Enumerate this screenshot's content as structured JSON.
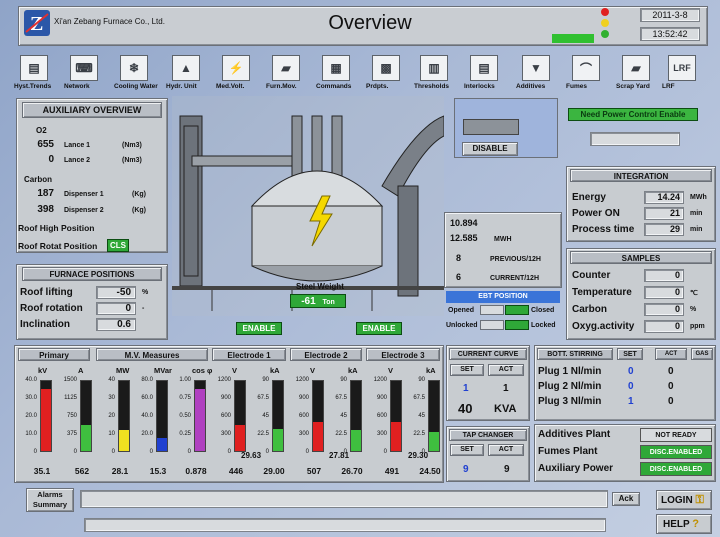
{
  "header": {
    "company": "Xi'an Zebang Furnace Co., Ltd.",
    "title": "Overview",
    "date": "2011-3-8",
    "time": "13:52:42"
  },
  "toolbar": [
    {
      "label": "Hyst.Trends",
      "icon": "trend-icon"
    },
    {
      "label": "Network",
      "icon": "network-icon"
    },
    {
      "label": "Cooling Water",
      "icon": "cooling-water-icon"
    },
    {
      "label": "Hydr. Unit",
      "icon": "hydraulic-icon"
    },
    {
      "label": "Med.Volt.",
      "icon": "medium-voltage-icon"
    },
    {
      "label": "Furn.Mov.",
      "icon": "furnace-movement-icon"
    },
    {
      "label": "Commands",
      "icon": "commands-icon"
    },
    {
      "label": "Prdpts.",
      "icon": "production-icon"
    },
    {
      "label": "Thresholds",
      "icon": "thresholds-icon"
    },
    {
      "label": "Interlocks",
      "icon": "interlocks-icon"
    },
    {
      "label": "Additives",
      "icon": "additives-icon"
    },
    {
      "label": "Fumes",
      "icon": "fumes-icon"
    },
    {
      "label": "Scrap Yard",
      "icon": "scrap-yard-icon"
    },
    {
      "label": "LRF",
      "icon": "lrf-icon"
    }
  ],
  "auxiliary": {
    "title": "AUXILIARY OVERVIEW",
    "o2_label": "O2",
    "lance1": {
      "value": "655",
      "label": "Lance 1",
      "unit": "(Nm3)"
    },
    "lance2": {
      "value": "0",
      "label": "Lance 2",
      "unit": "(Nm3)"
    },
    "carbon_label": "Carbon",
    "disp1": {
      "value": "187",
      "label": "Dispenser 1",
      "unit": "(Kg)"
    },
    "disp2": {
      "value": "398",
      "label": "Dispenser 2",
      "unit": "(Kg)"
    },
    "roof_high": "Roof High Position",
    "roof_rotat": "Roof Rotat Position",
    "roof_rotat_badge": "CLS"
  },
  "furnace_positions": {
    "title": "FURNACE POSITIONS",
    "rows": [
      {
        "label": "Roof lifting",
        "value": "-50",
        "unit": "%"
      },
      {
        "label": "Roof rotation",
        "value": "0",
        "unit": "-"
      },
      {
        "label": "Inclination",
        "value": "0.6",
        "unit": ""
      }
    ]
  },
  "center": {
    "steel_weight_label": "Steel Weight",
    "steel_weight_value": "-61",
    "steel_weight_unit": "Ton",
    "enable_left": "ENABLE",
    "enable_right": "ENABLE",
    "disable": "DISABLE"
  },
  "energy": {
    "v1": "10.894",
    "v2": "12.585",
    "unit": "MWH",
    "prev_val": "8",
    "prev_label": "PREVIOUS/12H",
    "curr_val": "6",
    "curr_label": "CURRENT/12H"
  },
  "ebt": {
    "title": "EBT POSITION",
    "opened": "Opened",
    "closed": "Closed",
    "unlocked": "Unlocked",
    "locked": "Locked"
  },
  "power_control": {
    "label": "Need Power Control Enable"
  },
  "integration": {
    "title": "INTEGRATION",
    "rows": [
      {
        "label": "Energy",
        "value": "14.24",
        "unit": "MWh"
      },
      {
        "label": "Power ON",
        "value": "21",
        "unit": "min"
      },
      {
        "label": "Process time",
        "value": "29",
        "unit": "min"
      }
    ]
  },
  "samples": {
    "title": "SAMPLES",
    "rows": [
      {
        "label": "Counter",
        "value": "0",
        "unit": ""
      },
      {
        "label": "Temperature",
        "value": "0",
        "unit": "℃"
      },
      {
        "label": "Carbon",
        "value": "0",
        "unit": "%"
      },
      {
        "label": "Oxyg.activity",
        "value": "0",
        "unit": "ppm"
      }
    ]
  },
  "gauges": {
    "primary_title": "Primary",
    "mv_title": "M.V. Measures",
    "e1_title": "Electrode 1",
    "e2_title": "Electrode 2",
    "e3_title": "Electrode 3",
    "columns": [
      {
        "unit": "kV",
        "ticks": [
          "40.0",
          "30.0",
          "20.0",
          "10.0",
          "0"
        ],
        "value": "35.1",
        "fill": 0.88,
        "color": "#e02020"
      },
      {
        "unit": "A",
        "ticks": [
          "1500",
          "1125",
          "750",
          "375",
          "0"
        ],
        "value": "562",
        "fill": 0.37,
        "color": "#3fbf3f"
      },
      {
        "unit": "MW",
        "ticks": [
          "40",
          "30",
          "20",
          "10",
          "0"
        ],
        "value": "28.1",
        "fill": 0.3,
        "color": "#f0e020"
      },
      {
        "unit": "MVar",
        "ticks": [
          "80.0",
          "60.0",
          "40.0",
          "20.0",
          "0"
        ],
        "value": "15.3",
        "fill": 0.19,
        "color": "#2040d0"
      },
      {
        "unit": "cos φ",
        "ticks": [
          "1.00",
          "0.75",
          "0.50",
          "0.25",
          "0"
        ],
        "value": "0.878",
        "fill": 0.88,
        "color": "#b040c0"
      },
      {
        "unit": "V",
        "ticks": [
          "1200",
          "900",
          "600",
          "300",
          "0"
        ],
        "value": "446",
        "fill": 0.37,
        "color": "#e02020"
      },
      {
        "unit": "kA",
        "ticks": [
          "90",
          "67.5",
          "45",
          "22.5",
          "0"
        ],
        "value": "29.00",
        "fill": 0.32,
        "color": "#3fbf3f"
      },
      {
        "unit": "V",
        "ticks": [
          "1200",
          "900",
          "600",
          "300",
          "0"
        ],
        "value": "507",
        "fill": 0.42,
        "color": "#e02020"
      },
      {
        "unit": "kA",
        "ticks": [
          "90",
          "67.5",
          "45",
          "22.5",
          "0"
        ],
        "value": "26.70",
        "fill": 0.3,
        "color": "#3fbf3f"
      },
      {
        "unit": "V",
        "ticks": [
          "1200",
          "900",
          "600",
          "300",
          "0"
        ],
        "value": "491",
        "fill": 0.41,
        "color": "#e02020"
      },
      {
        "unit": "kA",
        "ticks": [
          "90",
          "67.5",
          "45",
          "22.5",
          "0"
        ],
        "value": "24.50",
        "fill": 0.27,
        "color": "#3fbf3f"
      }
    ],
    "e1_inner": "29.63",
    "e2_inner": "27.81",
    "e3_inner": "29.30"
  },
  "current_curve": {
    "title": "CURRENT CURVE",
    "set": "SET",
    "act": "ACT",
    "set_val": "1",
    "act_val": "1",
    "kva_val": "40",
    "kva_unit": "KVA"
  },
  "tap_changer": {
    "title": "TAP CHANGER",
    "set": "SET",
    "act": "ACT",
    "set_val": "9",
    "act_val": "9"
  },
  "bott_stirring": {
    "title": "BOTT. STIRRING",
    "set": "SET",
    "act": "ACT",
    "gas": "GAS",
    "rows": [
      {
        "label": "Plug 1 Nl/min",
        "set": "0",
        "act": "0"
      },
      {
        "label": "Plug 2 Nl/min",
        "set": "0",
        "act": "0"
      },
      {
        "label": "Plug 3 Nl/min",
        "set": "1",
        "act": "0"
      }
    ]
  },
  "plants": [
    {
      "label": "Additives Plant",
      "status": "NOT READY",
      "color": "#d8dbde",
      "text_color": "#111111"
    },
    {
      "label": "Fumes Plant",
      "status": "DISC.ENABLED",
      "color": "#2fa838",
      "text_color": "#ffffff"
    },
    {
      "label": "Auxiliary Power",
      "status": "DISC.ENABLED",
      "color": "#2fa838",
      "text_color": "#ffffff"
    }
  ],
  "footer": {
    "alarms": "Alarms Summary",
    "ack": "Ack",
    "login": "LOGIN",
    "help": "HELP"
  }
}
